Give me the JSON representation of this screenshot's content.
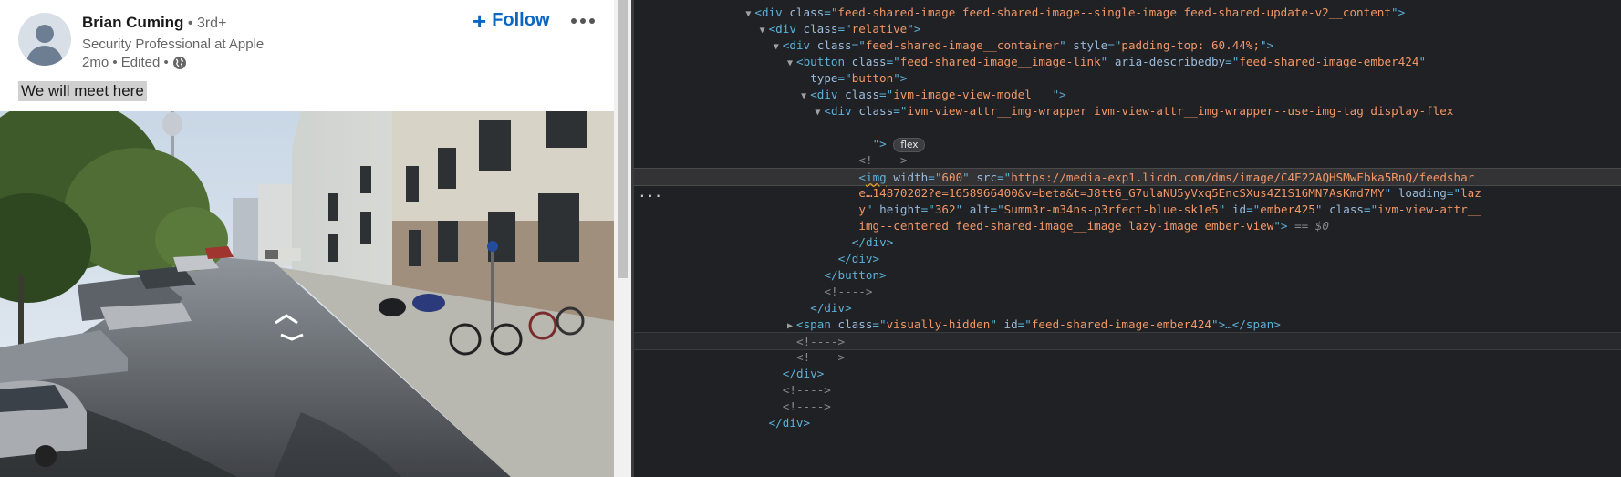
{
  "post": {
    "author_name": "Brian Cuming",
    "degree": " • 3rd+",
    "headline": "Security Professional at Apple",
    "time_edited": "2mo • Edited •",
    "follow_label": "Follow",
    "follow_icon": "+",
    "text": "We will meet here",
    "image_alt": "Summ3r-m34ns-p3rfect-blue-sk1e5"
  },
  "devtools": {
    "lines": [
      {
        "indent": 14,
        "twisty": "▼",
        "parts": [
          [
            "tag",
            "<div "
          ],
          [
            "attr",
            "class"
          ],
          [
            "tag",
            "=\""
          ],
          [
            "val",
            "feed-shared-image feed-shared-image--single-image feed-shared-update-v2__content"
          ],
          [
            "tag",
            "\">"
          ]
        ]
      },
      {
        "indent": 16,
        "twisty": "▼",
        "parts": [
          [
            "tag",
            "<div "
          ],
          [
            "attr",
            "class"
          ],
          [
            "tag",
            "=\""
          ],
          [
            "val",
            "relative"
          ],
          [
            "tag",
            "\">"
          ]
        ]
      },
      {
        "indent": 18,
        "twisty": "▼",
        "parts": [
          [
            "tag",
            "<div "
          ],
          [
            "attr",
            "class"
          ],
          [
            "tag",
            "=\""
          ],
          [
            "val",
            "feed-shared-image__container"
          ],
          [
            "tag",
            "\" "
          ],
          [
            "attr",
            "style"
          ],
          [
            "tag",
            "=\""
          ],
          [
            "val",
            "padding-top: 60.44%;"
          ],
          [
            "tag",
            "\">"
          ]
        ]
      },
      {
        "indent": 20,
        "twisty": "▼",
        "parts": [
          [
            "tag",
            "<button "
          ],
          [
            "attr",
            "class"
          ],
          [
            "tag",
            "=\""
          ],
          [
            "val",
            "feed-shared-image__image-link"
          ],
          [
            "tag",
            "\" "
          ],
          [
            "attr",
            "aria-describedby"
          ],
          [
            "tag",
            "=\""
          ],
          [
            "val",
            "feed-shared-image-ember424"
          ],
          [
            "tag",
            "\""
          ]
        ]
      },
      {
        "indent": 22,
        "twisty": "",
        "parts": [
          [
            "attr",
            "type"
          ],
          [
            "tag",
            "=\""
          ],
          [
            "val",
            "button"
          ],
          [
            "tag",
            "\">"
          ]
        ]
      },
      {
        "indent": 22,
        "twisty": "▼",
        "parts": [
          [
            "tag",
            "<div "
          ],
          [
            "attr",
            "class"
          ],
          [
            "tag",
            "=\""
          ],
          [
            "val",
            "ivm-image-view-model   "
          ],
          [
            "tag",
            "\">"
          ]
        ]
      },
      {
        "indent": 24,
        "twisty": "▼",
        "parts": [
          [
            "tag",
            "<div "
          ],
          [
            "attr",
            "class"
          ],
          [
            "tag",
            "=\""
          ],
          [
            "val",
            "ivm-view-attr__img-wrapper ivm-view-attr__img-wrapper--use-img-tag display-flex"
          ]
        ]
      },
      {
        "indent": 24,
        "twisty": "",
        "parts": []
      },
      {
        "indent": 31,
        "twisty": "",
        "parts": [
          [
            "tag",
            "\"> "
          ],
          [
            "badge",
            "flex"
          ]
        ]
      },
      {
        "indent": 29,
        "twisty": "",
        "parts": [
          [
            "cmt",
            "<!---->"
          ]
        ]
      },
      {
        "indent": 29,
        "twisty": "",
        "parts": [
          [
            "tag",
            "<"
          ],
          [
            "tagsq",
            "img"
          ],
          [
            "tag",
            " "
          ],
          [
            "attr",
            "width"
          ],
          [
            "tag",
            "=\""
          ],
          [
            "val",
            "600"
          ],
          [
            "tag",
            "\" "
          ],
          [
            "attr",
            "src"
          ],
          [
            "tag",
            "=\""
          ],
          [
            "val",
            "https://media-exp1.licdn.com/dms/image/C4E22AQHSMwEbka5RnQ/feedshar"
          ]
        ]
      },
      {
        "indent": 29,
        "twisty": "",
        "parts": [
          [
            "val",
            "e…14870202?e=1658966400&v=beta&t=J8ttG_G7ulaNU5yVxq5EncSXus4Z1S16MN7AsKmd7MY"
          ],
          [
            "tag",
            "\" "
          ],
          [
            "attr",
            "loading"
          ],
          [
            "tag",
            "=\""
          ],
          [
            "val",
            "laz"
          ]
        ]
      },
      {
        "indent": 29,
        "twisty": "",
        "parts": [
          [
            "val",
            "y"
          ],
          [
            "tag",
            "\" "
          ],
          [
            "attr",
            "height"
          ],
          [
            "tag",
            "=\""
          ],
          [
            "val",
            "362"
          ],
          [
            "tag",
            "\" "
          ],
          [
            "attr",
            "alt"
          ],
          [
            "tag",
            "=\""
          ],
          [
            "val",
            "Summ3r-m34ns-p3rfect-blue-sk1e5"
          ],
          [
            "tag",
            "\" "
          ],
          [
            "attr",
            "id"
          ],
          [
            "tag",
            "=\""
          ],
          [
            "val",
            "ember425"
          ],
          [
            "tag",
            "\" "
          ],
          [
            "attr",
            "class"
          ],
          [
            "tag",
            "=\""
          ],
          [
            "val",
            "ivm-view-attr__"
          ]
        ]
      },
      {
        "indent": 29,
        "twisty": "",
        "parts": [
          [
            "val",
            "img--centered feed-shared-image__image lazy-image ember-view"
          ],
          [
            "tag",
            "\">"
          ],
          [
            "ref",
            " == $0"
          ]
        ]
      },
      {
        "indent": 28,
        "twisty": "",
        "parts": [
          [
            "tag",
            "</div>"
          ]
        ]
      },
      {
        "indent": 26,
        "twisty": "",
        "parts": [
          [
            "tag",
            "</div>"
          ]
        ]
      },
      {
        "indent": 24,
        "twisty": "",
        "parts": [
          [
            "tag",
            "</button>"
          ]
        ]
      },
      {
        "indent": 24,
        "twisty": "",
        "parts": [
          [
            "cmt",
            "<!---->"
          ]
        ]
      },
      {
        "indent": 22,
        "twisty": "",
        "parts": [
          [
            "tag",
            "</div>"
          ]
        ]
      },
      {
        "indent": 20,
        "twisty": "▶",
        "parts": [
          [
            "tag",
            "<span "
          ],
          [
            "attr",
            "class"
          ],
          [
            "tag",
            "=\""
          ],
          [
            "val",
            "visually-hidden"
          ],
          [
            "tag",
            "\" "
          ],
          [
            "attr",
            "id"
          ],
          [
            "tag",
            "=\""
          ],
          [
            "val",
            "feed-shared-image-ember424"
          ],
          [
            "tag",
            "\">…</span>"
          ]
        ]
      },
      {
        "indent": 20,
        "twisty": "",
        "parts": [
          [
            "cmt",
            "<!---->"
          ]
        ]
      },
      {
        "indent": 20,
        "twisty": "",
        "parts": [
          [
            "cmt",
            "<!---->"
          ]
        ]
      },
      {
        "indent": 18,
        "twisty": "",
        "parts": [
          [
            "tag",
            "</div>"
          ]
        ]
      },
      {
        "indent": 18,
        "twisty": "",
        "parts": [
          [
            "cmt",
            "<!---->"
          ]
        ]
      },
      {
        "indent": 18,
        "twisty": "",
        "parts": [
          [
            "cmt",
            "<!---->"
          ]
        ]
      },
      {
        "indent": 16,
        "twisty": "",
        "parts": [
          [
            "tag",
            "</div>"
          ]
        ]
      }
    ],
    "gutter_dots": "...",
    "selected_index": 10,
    "hover_index": 20
  }
}
